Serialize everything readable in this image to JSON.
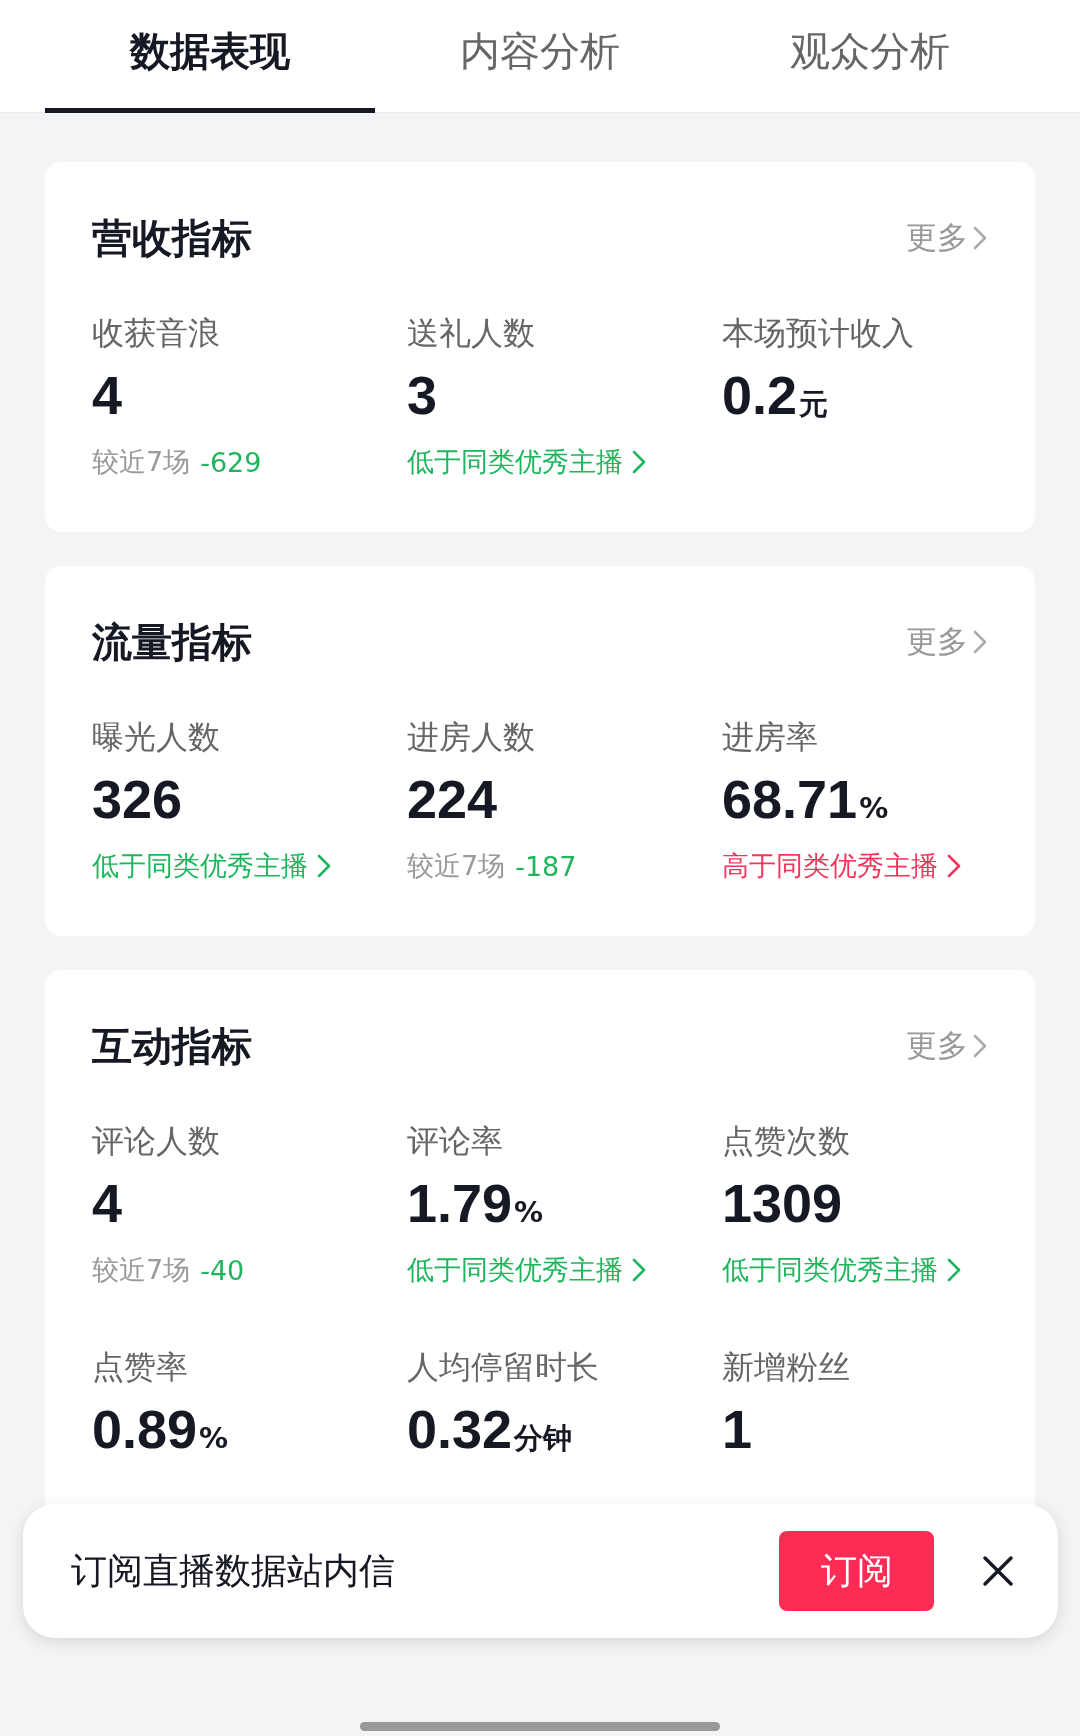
{
  "tabs": [
    {
      "label": "数据表现",
      "selected": true
    },
    {
      "label": "内容分析",
      "selected": false
    },
    {
      "label": "观众分析",
      "selected": false
    }
  ],
  "sections": [
    {
      "title": "营收指标",
      "more": "更多",
      "metrics": [
        {
          "label": "收获音浪",
          "value": "4",
          "sub": {
            "kind": "compare",
            "prefix": "较近7场",
            "delta": "-629",
            "color": "#1fb55d"
          }
        },
        {
          "label": "送礼人数",
          "value": "3",
          "sub": {
            "kind": "benchmark",
            "text": "低于同类优秀主播",
            "color": "#1fb55d"
          }
        },
        {
          "label": "本场预计收入",
          "value": "0.2",
          "unit": "元"
        }
      ]
    },
    {
      "title": "流量指标",
      "more": "更多",
      "metrics": [
        {
          "label": "曝光人数",
          "value": "326",
          "sub": {
            "kind": "benchmark",
            "text": "低于同类优秀主播",
            "color": "#1fb55d"
          }
        },
        {
          "label": "进房人数",
          "value": "224",
          "sub": {
            "kind": "compare",
            "prefix": "较近7场",
            "delta": "-187",
            "color": "#1fb55d"
          }
        },
        {
          "label": "进房率",
          "value": "68.71",
          "unit": "%",
          "sub": {
            "kind": "benchmark",
            "text": "高于同类优秀主播",
            "color": "#f2355b"
          }
        }
      ]
    },
    {
      "title": "互动指标",
      "more": "更多",
      "metrics": [
        {
          "label": "评论人数",
          "value": "4",
          "sub": {
            "kind": "compare",
            "prefix": "较近7场",
            "delta": "-40",
            "color": "#1fb55d"
          }
        },
        {
          "label": "评论率",
          "value": "1.79",
          "unit": "%",
          "sub": {
            "kind": "benchmark",
            "text": "低于同类优秀主播",
            "color": "#1fb55d"
          }
        },
        {
          "label": "点赞次数",
          "value": "1309",
          "sub": {
            "kind": "benchmark",
            "text": "低于同类优秀主播",
            "color": "#1fb55d"
          }
        },
        {
          "label": "点赞率",
          "value": "0.89",
          "unit": "%"
        },
        {
          "label": "人均停留时长",
          "value": "0.32",
          "unit": "分钟"
        },
        {
          "label": "新增粉丝",
          "value": "1"
        }
      ]
    }
  ],
  "banner": {
    "text": "订阅直播数据站内信",
    "button": "订阅"
  }
}
